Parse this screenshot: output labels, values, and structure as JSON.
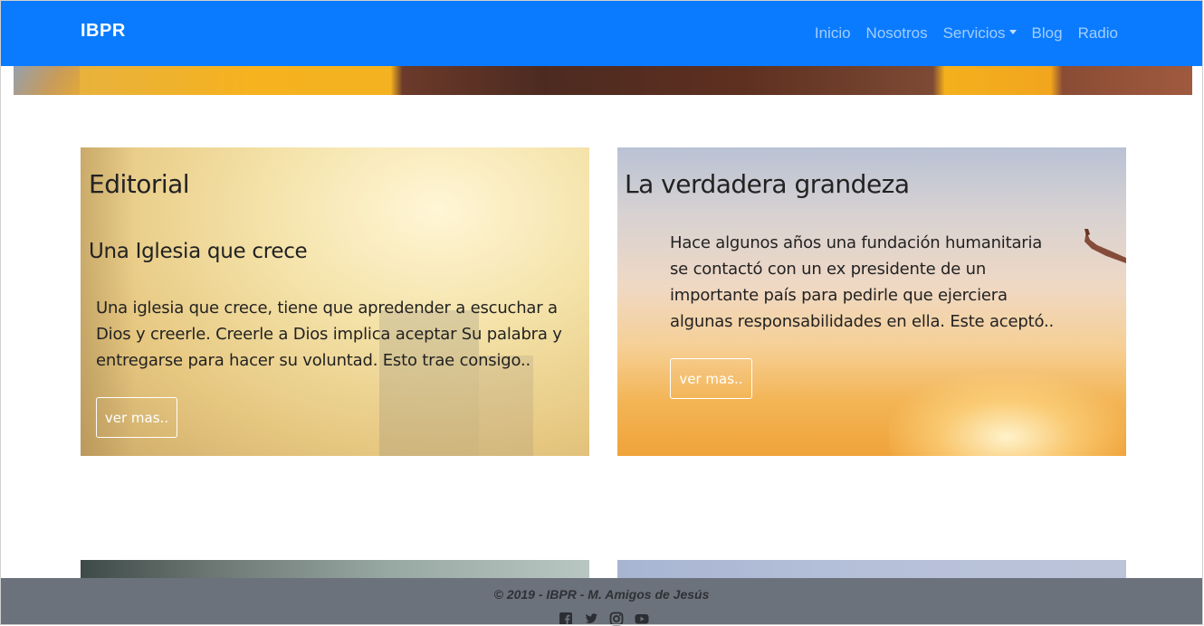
{
  "navbar": {
    "brand": "IBPR",
    "items": [
      {
        "label": "Inicio"
      },
      {
        "label": "Nosotros"
      },
      {
        "label": "Servicios",
        "dropdown": true
      },
      {
        "label": "Blog"
      },
      {
        "label": "Radio"
      }
    ]
  },
  "cards": [
    {
      "title": "Editorial",
      "subtitle": "Una Iglesia que crece",
      "lines": [
        "Una iglesia que crece, tiene que apredender a escuchar a",
        "Dios y creerle. Creerle a Dios implica aceptar Su palabra y",
        "entregarse para hacer su voluntad. Esto trae consigo.."
      ],
      "button": "ver mas.."
    },
    {
      "title": "La verdadera grandeza",
      "lines": [
        "Hace algunos años una fundación humanitaria",
        "se contactó con un ex presidente de un",
        "importante país para pedirle que ejerciera",
        "algunas responsabilidades en ella. Este aceptó.."
      ],
      "button": "ver mas.."
    }
  ],
  "footer": {
    "copyright": "© 2019 - IBPR - M. Amigos de Jesús",
    "social": [
      "facebook-icon",
      "twitter-icon",
      "instagram-icon",
      "youtube-icon"
    ]
  },
  "colors": {
    "navbar": "#0a7bff",
    "footer": "#6c727c"
  }
}
